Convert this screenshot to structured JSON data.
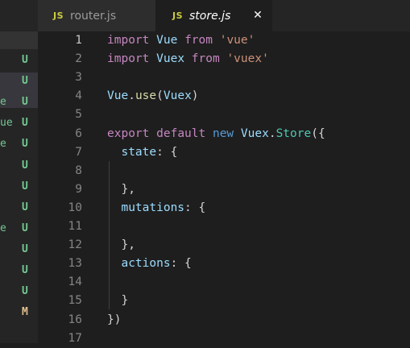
{
  "sidebar": {
    "rows": [
      {
        "fragment": "",
        "badge": "U"
      },
      {
        "fragment": "",
        "badge": "U"
      },
      {
        "fragment": "e",
        "badge": "U"
      },
      {
        "fragment": "ue",
        "badge": "U"
      },
      {
        "fragment": "e",
        "badge": "U"
      },
      {
        "fragment": "",
        "badge": "U"
      },
      {
        "fragment": "",
        "badge": "U"
      },
      {
        "fragment": "",
        "badge": "U"
      },
      {
        "fragment": "e",
        "badge": "U"
      },
      {
        "fragment": "",
        "badge": "U"
      },
      {
        "fragment": "",
        "badge": "U"
      },
      {
        "fragment": "",
        "badge": "U"
      },
      {
        "fragment": "",
        "badge": "M"
      }
    ]
  },
  "tabs": [
    {
      "icon_text": "JS",
      "label": "router.js",
      "active": false
    },
    {
      "icon_text": "JS",
      "label": "store.js",
      "active": true,
      "close_glyph": "✕"
    }
  ],
  "editor": {
    "current_line": 1,
    "lines": [
      {
        "n": "1",
        "tokens": [
          {
            "t": "import",
            "c": "kw"
          },
          {
            "t": " ",
            "c": "plain"
          },
          {
            "t": "Vue",
            "c": "var"
          },
          {
            "t": " ",
            "c": "plain"
          },
          {
            "t": "from",
            "c": "kw"
          },
          {
            "t": " ",
            "c": "plain"
          },
          {
            "t": "'vue'",
            "c": "str"
          }
        ]
      },
      {
        "n": "2",
        "tokens": [
          {
            "t": "import",
            "c": "kw"
          },
          {
            "t": " ",
            "c": "plain"
          },
          {
            "t": "Vuex",
            "c": "var"
          },
          {
            "t": " ",
            "c": "plain"
          },
          {
            "t": "from",
            "c": "kw"
          },
          {
            "t": " ",
            "c": "plain"
          },
          {
            "t": "'vuex'",
            "c": "str"
          }
        ]
      },
      {
        "n": "3",
        "tokens": []
      },
      {
        "n": "4",
        "tokens": [
          {
            "t": "Vue",
            "c": "var"
          },
          {
            "t": ".",
            "c": "plain"
          },
          {
            "t": "use",
            "c": "fn"
          },
          {
            "t": "(",
            "c": "plain"
          },
          {
            "t": "Vuex",
            "c": "var"
          },
          {
            "t": ")",
            "c": "plain"
          }
        ]
      },
      {
        "n": "5",
        "tokens": []
      },
      {
        "n": "6",
        "tokens": [
          {
            "t": "export",
            "c": "kw"
          },
          {
            "t": " ",
            "c": "plain"
          },
          {
            "t": "default",
            "c": "kw"
          },
          {
            "t": " ",
            "c": "plain"
          },
          {
            "t": "new",
            "c": "kw2"
          },
          {
            "t": " ",
            "c": "plain"
          },
          {
            "t": "Vuex",
            "c": "var"
          },
          {
            "t": ".",
            "c": "plain"
          },
          {
            "t": "Store",
            "c": "cls"
          },
          {
            "t": "({",
            "c": "plain"
          }
        ]
      },
      {
        "n": "7",
        "tokens": [
          {
            "t": "  ",
            "c": "plain"
          },
          {
            "t": "state",
            "c": "var"
          },
          {
            "t": ": {",
            "c": "plain"
          }
        ]
      },
      {
        "n": "8",
        "tokens": []
      },
      {
        "n": "9",
        "tokens": [
          {
            "t": "  },",
            "c": "plain"
          }
        ]
      },
      {
        "n": "10",
        "tokens": [
          {
            "t": "  ",
            "c": "plain"
          },
          {
            "t": "mutations",
            "c": "var"
          },
          {
            "t": ": {",
            "c": "plain"
          }
        ]
      },
      {
        "n": "11",
        "tokens": []
      },
      {
        "n": "12",
        "tokens": [
          {
            "t": "  },",
            "c": "plain"
          }
        ]
      },
      {
        "n": "13",
        "tokens": [
          {
            "t": "  ",
            "c": "plain"
          },
          {
            "t": "actions",
            "c": "var"
          },
          {
            "t": ": {",
            "c": "plain"
          }
        ]
      },
      {
        "n": "14",
        "tokens": []
      },
      {
        "n": "15",
        "tokens": [
          {
            "t": "  }",
            "c": "plain"
          }
        ]
      },
      {
        "n": "16",
        "tokens": [
          {
            "t": "})",
            "c": "plain"
          }
        ]
      },
      {
        "n": "17",
        "tokens": []
      }
    ]
  },
  "colors": {
    "keyword": "#c586c0",
    "keyword_blue": "#569cd6",
    "class": "#4ec9b0",
    "variable": "#9cdcfe",
    "string": "#ce9178",
    "function": "#dcdcaa",
    "untracked_badge": "#73c991",
    "modified_badge": "#e2c08d"
  }
}
